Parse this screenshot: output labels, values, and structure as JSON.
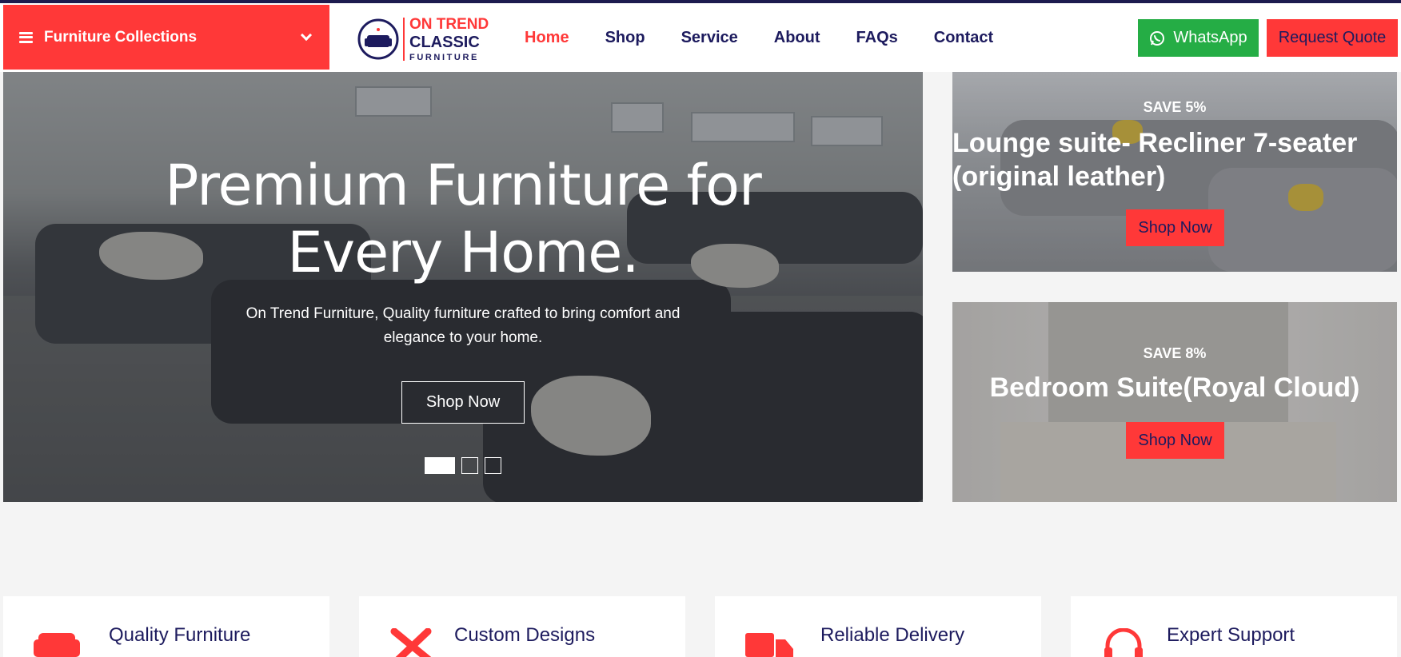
{
  "header": {
    "collections_label": "Furniture Collections",
    "logo": {
      "line1": "ON TREND",
      "line2": "CLASSIC",
      "line3": "FURNITURE"
    },
    "nav": [
      {
        "label": "Home",
        "active": true
      },
      {
        "label": "Shop",
        "active": false
      },
      {
        "label": "Service",
        "active": false
      },
      {
        "label": "About",
        "active": false
      },
      {
        "label": "FAQs",
        "active": false
      },
      {
        "label": "Contact",
        "active": false
      }
    ],
    "whatsapp_label": "WhatsApp",
    "quote_label": "Request Quote"
  },
  "hero": {
    "title_line1": "Premium Furniture for",
    "title_line2": "Every Home.",
    "subtitle_line1": "On Trend Furniture, Quality furniture crafted to bring comfort and",
    "subtitle_line2": "elegance to your home.",
    "button_label": "Shop Now",
    "slides": 3,
    "active_slide": 1
  },
  "promos": [
    {
      "save": "SAVE 5%",
      "title_line1": "Lounge suite- Recliner 7-seater",
      "title_line2": "(original leather)",
      "button_label": "Shop Now"
    },
    {
      "save": "SAVE 8%",
      "title_line1": "Bedroom Suite(Royal Cloud)",
      "title_line2": "",
      "button_label": "Shop Now"
    }
  ],
  "features": [
    {
      "title": "Quality Furniture",
      "icon": "sofa-icon"
    },
    {
      "title": "Custom Designs",
      "icon": "tools-icon"
    },
    {
      "title": "Reliable Delivery",
      "icon": "truck-icon"
    },
    {
      "title": "Expert Support",
      "icon": "headset-icon"
    }
  ],
  "colors": {
    "accent": "#ff3838",
    "navy": "#1d1b5e",
    "whatsapp": "#25ad45"
  }
}
